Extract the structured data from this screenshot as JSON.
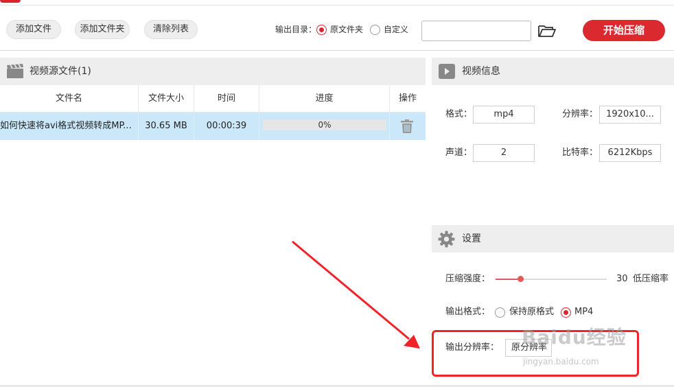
{
  "toolbar": {
    "add_file": "添加文件",
    "add_folder": "添加文件夹",
    "clear_list": "清除列表",
    "output_dir_label": "输出目录：",
    "option_original": "原文件夹",
    "option_custom": "自定义",
    "selected_option": "原文件夹",
    "output_path_value": "",
    "start_button": "开始压缩"
  },
  "source_panel": {
    "title": "视频源文件(1)",
    "columns": [
      "文件名",
      "文件大小",
      "时间",
      "进度",
      "操作"
    ],
    "rows": [
      {
        "filename": "如何快速将avi格式视频转成MP...",
        "size": "30.65 MB",
        "duration": "00:00:39",
        "progress_text": "0%",
        "progress": 0
      }
    ]
  },
  "video_info": {
    "title": "视频信息",
    "format_label": "格式：",
    "format_value": "mp4",
    "resolution_label": "分辨率：",
    "resolution_value": "1920x10...",
    "channel_label": "声道：",
    "channel_value": "2",
    "bitrate_label": "比特率：",
    "bitrate_value": "6212Kbps"
  },
  "settings": {
    "title": "设置",
    "strength_label": "压缩强度：",
    "strength_value": "30",
    "strength_level": 0.22,
    "strength_desc": "低压缩率",
    "output_format_label": "输出格式：",
    "keep_format_option": "保持原格式",
    "mp4_option": "MP4",
    "selected_format": "MP4",
    "output_resolution_label": "输出分辨率：",
    "output_resolution_value": "原分辨率"
  },
  "watermark": {
    "main": "Baidu经验",
    "sub": "jingyan.baidu.com"
  },
  "colors": {
    "accent": "#d9262e",
    "annotation": "#f0232b",
    "row_selected": "#cbe8fb",
    "panel_header": "#eeeeee"
  }
}
